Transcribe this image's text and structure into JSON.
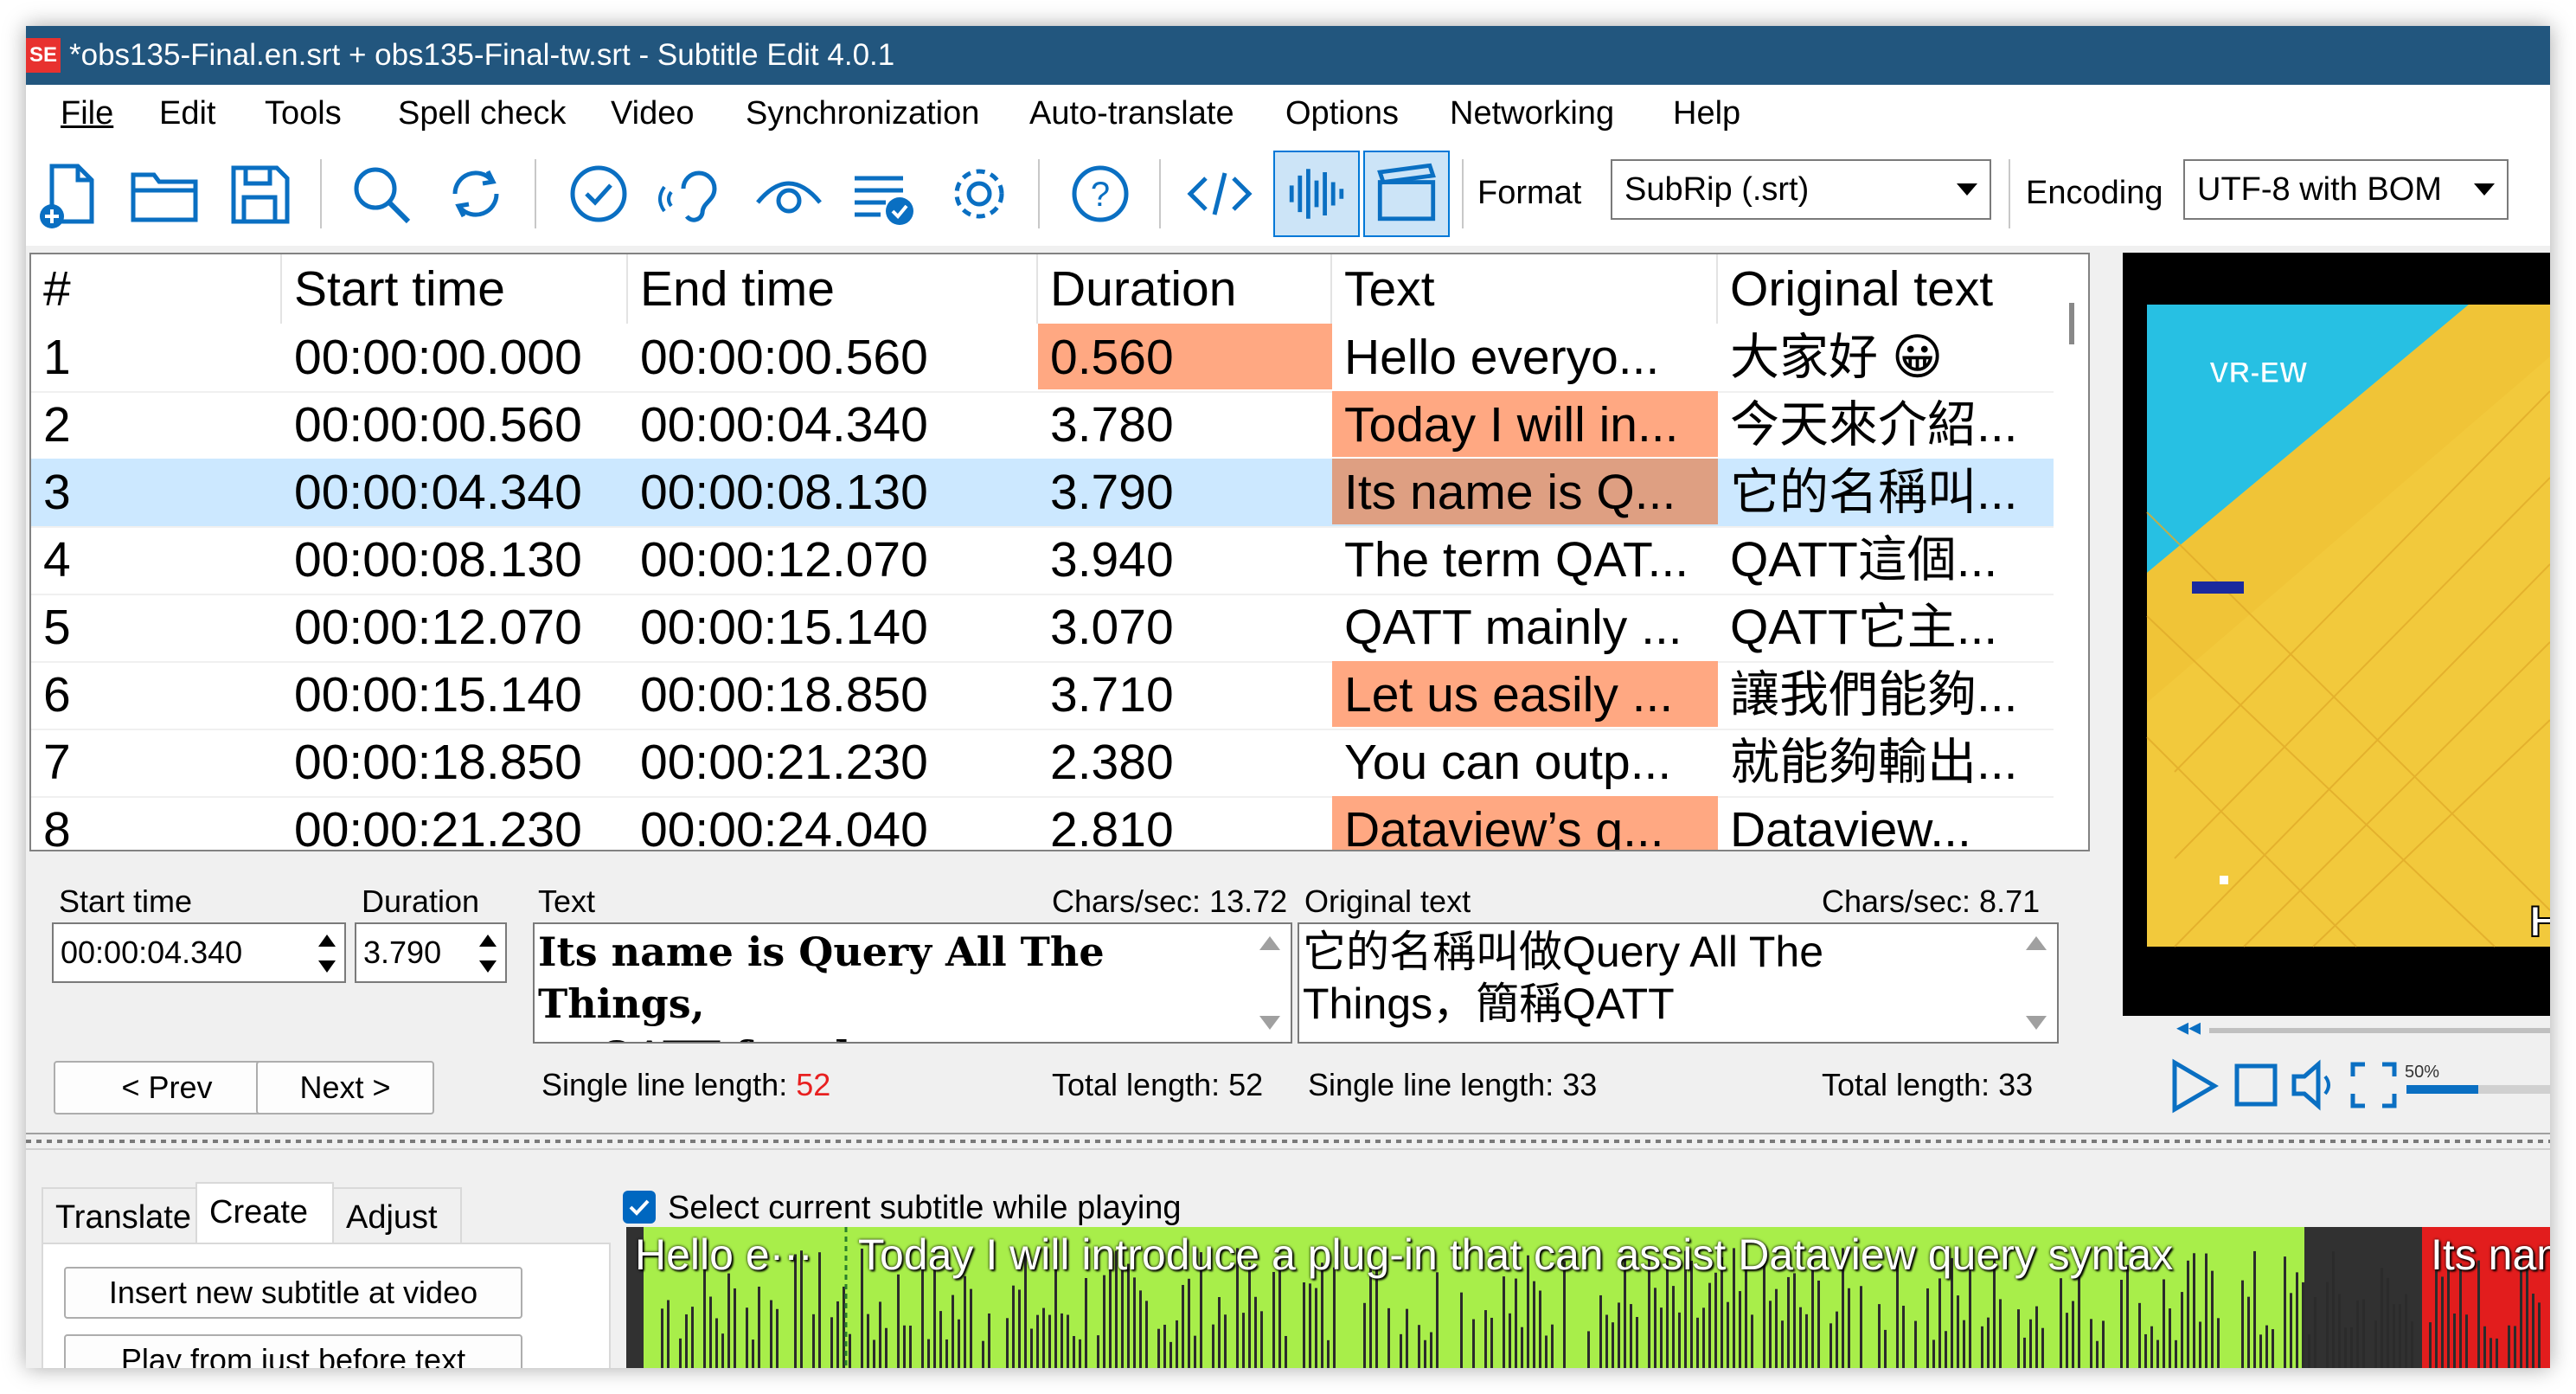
{
  "window": {
    "title": "*obs135-Final.en.srt + obs135-Final-tw.srt - Subtitle Edit 4.0.1",
    "logo_text": "SE"
  },
  "menu": [
    "File",
    "Edit",
    "Tools",
    "Spell check",
    "Video",
    "Synchronization",
    "Auto-translate",
    "Options",
    "Networking",
    "Help"
  ],
  "toolbar": {
    "icons": [
      "new-file-icon",
      "open-folder-icon",
      "save-icon",
      "search-icon",
      "replace-icon",
      "spell-check-icon",
      "listen-icon",
      "visual-sync-icon",
      "fix-errors-icon",
      "settings-icon",
      "help-icon",
      "source-view-icon",
      "waveform-icon",
      "video-icon"
    ],
    "format_label": "Format",
    "format_value": "SubRip (.srt)",
    "encoding_label": "Encoding",
    "encoding_value": "UTF-8 with BOM"
  },
  "grid": {
    "columns": [
      "#",
      "Start time",
      "End time",
      "Duration",
      "Text",
      "Original text"
    ],
    "rows": [
      {
        "num": "1",
        "start": "00:00:00.000",
        "end": "00:00:00.560",
        "duration": "0.560",
        "text": "Hello everyo...",
        "original": "大家好 😀"
      },
      {
        "num": "2",
        "start": "00:00:00.560",
        "end": "00:00:04.340",
        "duration": "3.780",
        "text": "Today I will in...",
        "original": "今天來介紹..."
      },
      {
        "num": "3",
        "start": "00:00:04.340",
        "end": "00:00:08.130",
        "duration": "3.790",
        "text": "Its name is Q...",
        "original": "它的名稱叫..."
      },
      {
        "num": "4",
        "start": "00:00:08.130",
        "end": "00:00:12.070",
        "duration": "3.940",
        "text": "The term QAT...",
        "original": "QATT這個..."
      },
      {
        "num": "5",
        "start": "00:00:12.070",
        "end": "00:00:15.140",
        "duration": "3.070",
        "text": "QATT mainly ...",
        "original": "QATT它主..."
      },
      {
        "num": "6",
        "start": "00:00:15.140",
        "end": "00:00:18.850",
        "duration": "3.710",
        "text": "Let us easily ...",
        "original": "讓我們能夠..."
      },
      {
        "num": "7",
        "start": "00:00:18.850",
        "end": "00:00:21.230",
        "duration": "2.380",
        "text": "You can outp...",
        "original": "就能夠輸出..."
      },
      {
        "num": "8",
        "start": "00:00:21.230",
        "end": "00:00:24.040",
        "duration": "2.810",
        "text": "Dataview’s q...",
        "original": "Dataview..."
      }
    ]
  },
  "editor": {
    "start_time_label": "Start time",
    "start_time_value": "00:00:04.340",
    "duration_label": "Duration",
    "duration_value": "3.790",
    "text_label": "Text",
    "text_cps": "Chars/sec: 13.72",
    "text_line1": "Its name is Query All The Things,",
    "text_line2": "or QATT for short.",
    "orig_label": "Original text",
    "orig_cps": "Chars/sec: 8.71",
    "orig_line1": "它的名稱叫做Query All The",
    "orig_line2": "Things，簡稱QATT",
    "prev_label": "< Prev",
    "next_label": "Next >",
    "text_single_line_label": "Single line length: ",
    "text_single_line_value": "52",
    "text_total_length": "Total length: 52",
    "orig_single_line_label": "Single line length: ",
    "orig_single_line_value": "33",
    "orig_total_length": "Total length: 33"
  },
  "video": {
    "overlay_text": "VR-EW",
    "edge_letter": "H",
    "volume_label": "50%",
    "volume_level": 0.5
  },
  "bottom": {
    "tabs": [
      "Translate",
      "Create",
      "Adjust"
    ],
    "active_tab": "Create",
    "buttons": [
      "Insert new subtitle at video",
      "Play from just before text"
    ],
    "checkbox_label": "Select current subtitle while playing",
    "waveform_texts": [
      "Hello e···",
      "Today I will introduce a plug-in that can assist Dataview query syntax",
      "Its name is"
    ]
  },
  "colors": {
    "titlebar": "#22567e",
    "duration_warning": "#ffa882",
    "selected_row": "#cce8ff",
    "waveform_green": "#a8ee4a",
    "waveform_selected": "#e21d1d"
  }
}
